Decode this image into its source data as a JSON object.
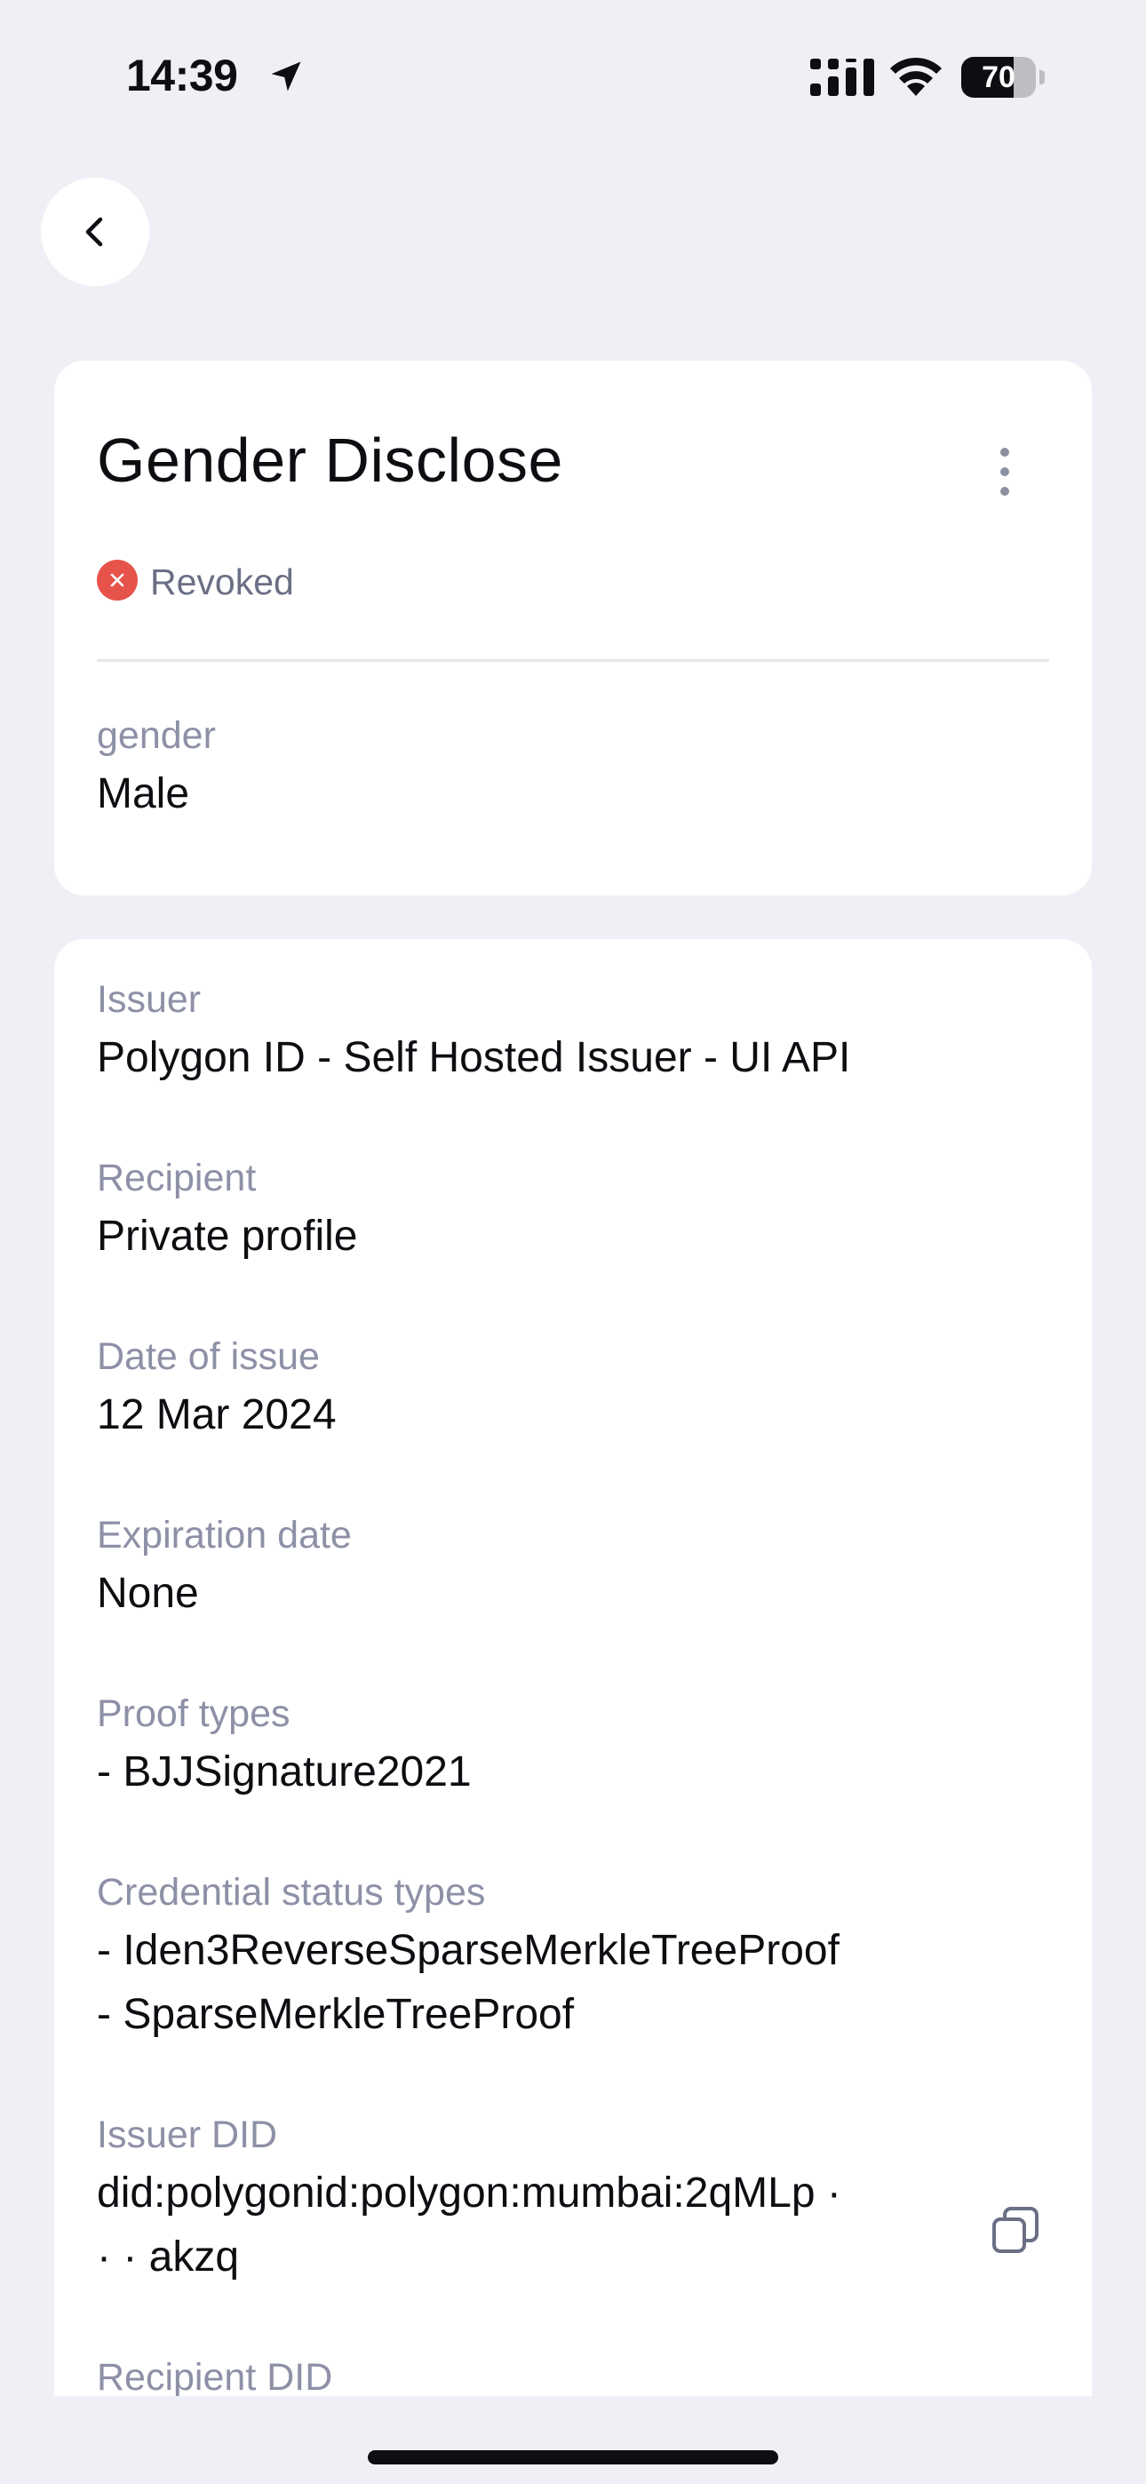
{
  "status_bar": {
    "time": "14:39",
    "battery": "70",
    "battery_level": 0.7,
    "icons": [
      "location-arrow-icon",
      "cellular-signal-icon",
      "wifi-icon",
      "battery-icon"
    ]
  },
  "nav": {
    "back_icon": "chevron-left-icon"
  },
  "credential": {
    "title": "Gender Disclose",
    "status": "Revoked",
    "status_color": "#e5534b",
    "attribute_label": "gender",
    "attribute_value": "Male"
  },
  "details": {
    "issuer_label": "Issuer",
    "issuer_value": "Polygon ID - Self Hosted Issuer - UI API",
    "recipient_label": "Recipient",
    "recipient_value": "Private profile",
    "date_label": "Date of issue",
    "date_value": "12 Mar 2024",
    "expiration_label": "Expiration date",
    "expiration_value": "None",
    "proof_label": "Proof types",
    "proof_value": "- BJJSignature2021",
    "status_types_label": "Credential status types",
    "status_types": [
      "- Iden3ReverseSparseMerkleTreeProof",
      "- SparseMerkleTreeProof"
    ],
    "issuer_did_label": "Issuer DID",
    "issuer_did_line1": "did:polygonid:polygon:mumbai:2qMLp ·",
    "issuer_did_line2": "· · akzq",
    "recipient_did_label": "Recipient DID"
  },
  "colors": {
    "background": "#eef0f5",
    "card": "#ffffff",
    "label": "#8d90a6",
    "revoked": "#e5534b"
  }
}
